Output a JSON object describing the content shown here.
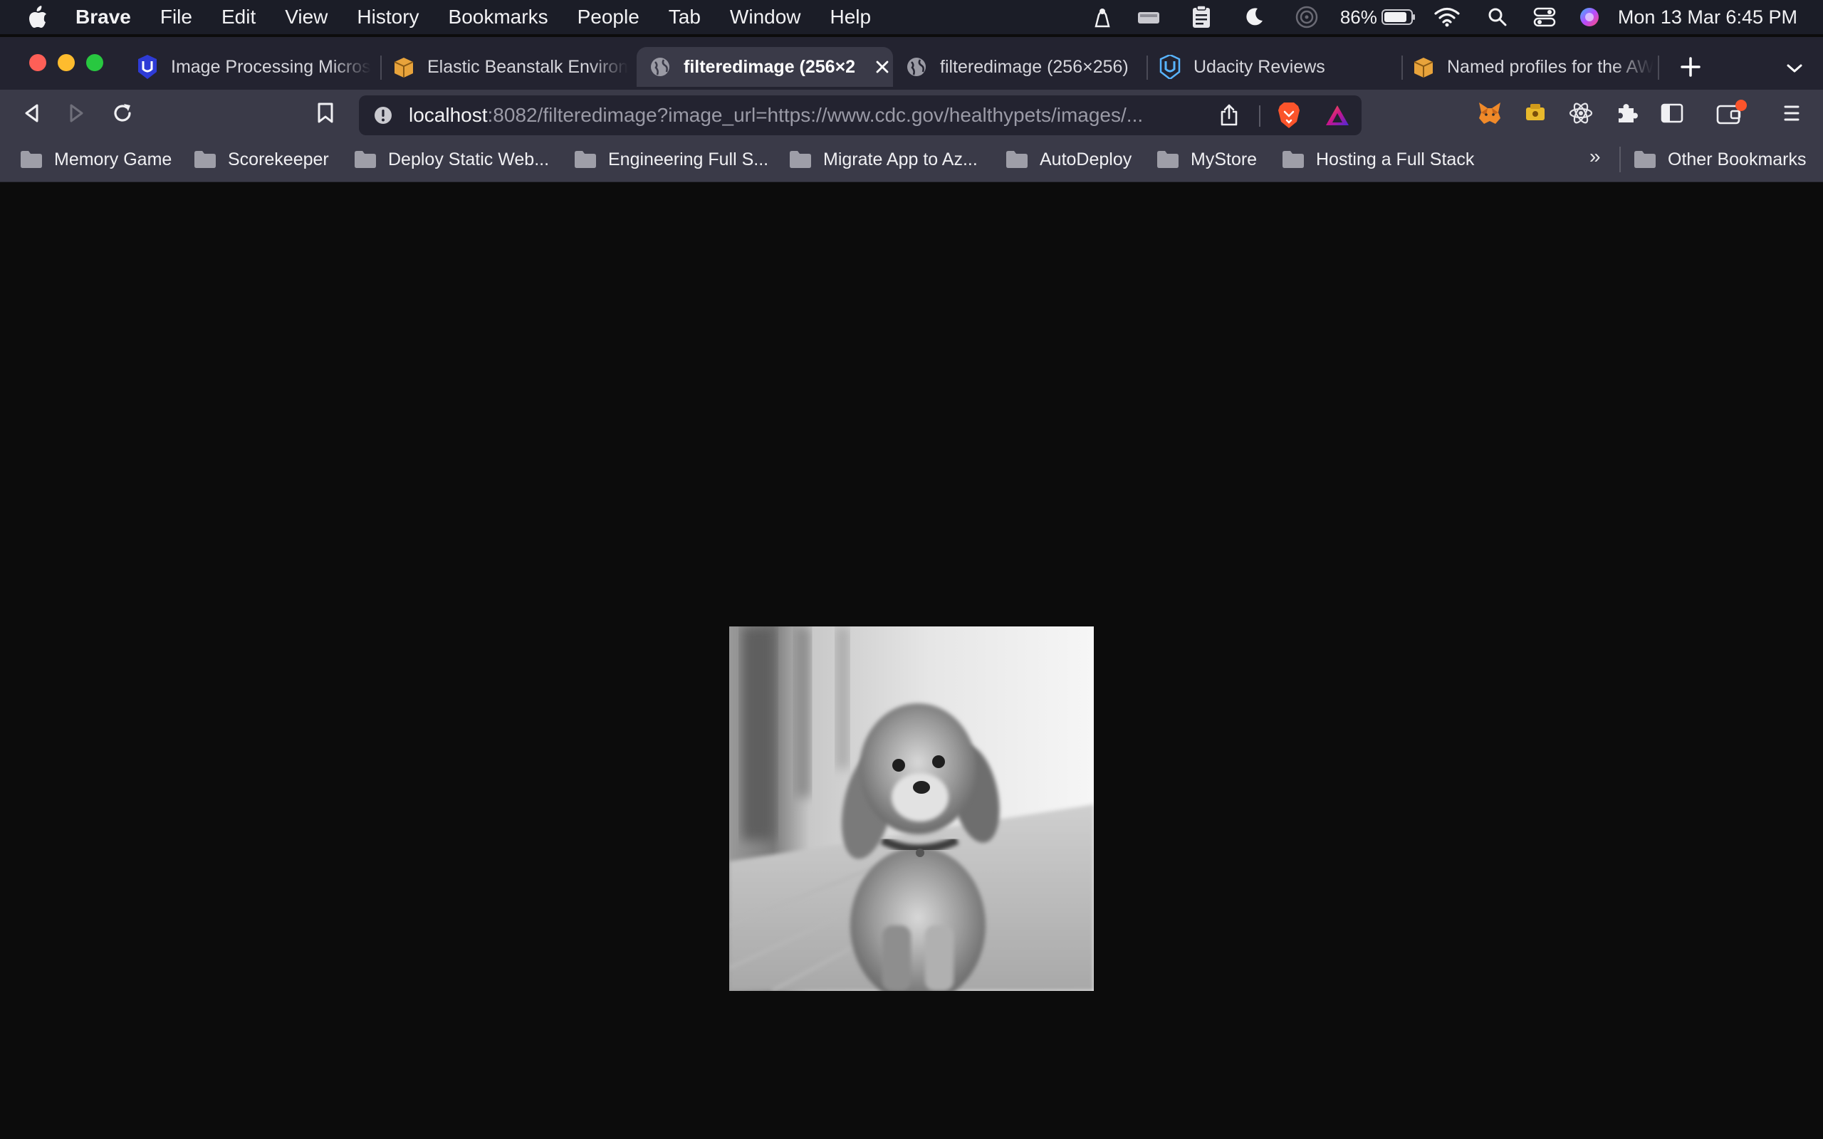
{
  "menubar": {
    "app_name": "Brave",
    "items": [
      "File",
      "Edit",
      "View",
      "History",
      "Bookmarks",
      "People",
      "Tab",
      "Window",
      "Help"
    ],
    "battery_percent": "86%",
    "datetime": "Mon 13 Mar  6:45 PM"
  },
  "tabs": [
    {
      "title": "Image Processing Micros",
      "icon": "udacity-icon"
    },
    {
      "title": "Elastic Beanstalk Environ",
      "icon": "aws-box-icon"
    },
    {
      "title": "filteredimage (256×2",
      "icon": "globe-icon",
      "active": true
    },
    {
      "title": "filteredimage (256×256)",
      "icon": "globe-icon"
    },
    {
      "title": "Udacity Reviews",
      "icon": "udacity-icon"
    },
    {
      "title": "Named profiles for the AW",
      "icon": "aws-box-icon"
    }
  ],
  "address_bar": {
    "host": "localhost",
    "path": ":8082/filteredimage?image_url=https://www.cdc.gov/healthypets/images/..."
  },
  "bookmarks": {
    "items": [
      "Memory Game",
      "Scorekeeper",
      "Deploy Static Web...",
      "Engineering Full S...",
      "Migrate App to Az...",
      "AutoDeploy",
      "MyStore",
      "Hosting a Full Stack"
    ],
    "overflow": "»",
    "other": "Other Bookmarks"
  },
  "content": {
    "image_alt": "filteredimage (256×256)"
  },
  "colors": {
    "page_background": "#0c0c0c",
    "toolbar": "#3a3a48",
    "tabstrip": "#232330",
    "menubar": "#1b1d27",
    "brave_orange": "#fb542b"
  }
}
